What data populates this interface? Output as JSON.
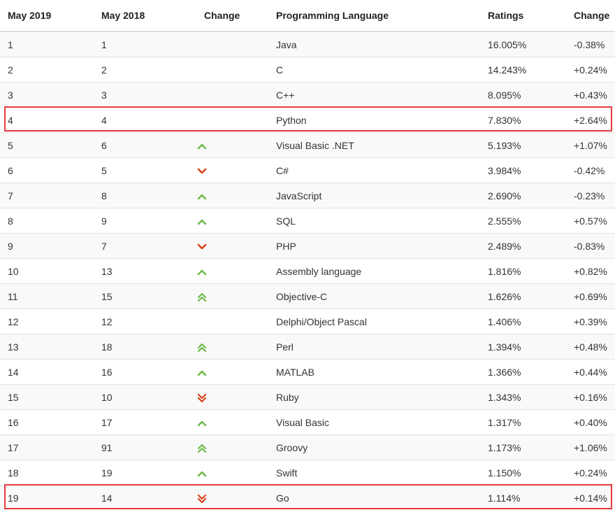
{
  "headers": [
    "May 2019",
    "May 2018",
    "Change",
    "Programming Language",
    "Ratings",
    "Change"
  ],
  "colors": {
    "up": "#6dbb4a",
    "down": "#d9401a",
    "highlight": "#e53a40"
  },
  "rows": [
    {
      "rank2019": "1",
      "rank2018": "1",
      "change_icon": "",
      "language": "Java",
      "rating": "16.005%",
      "delta": "-0.38%"
    },
    {
      "rank2019": "2",
      "rank2018": "2",
      "change_icon": "",
      "language": "C",
      "rating": "14.243%",
      "delta": "+0.24%"
    },
    {
      "rank2019": "3",
      "rank2018": "3",
      "change_icon": "",
      "language": "C++",
      "rating": "8.095%",
      "delta": "+0.43%"
    },
    {
      "rank2019": "4",
      "rank2018": "4",
      "change_icon": "",
      "language": "Python",
      "rating": "7.830%",
      "delta": "+2.64%"
    },
    {
      "rank2019": "5",
      "rank2018": "6",
      "change_icon": "chevron-up-icon",
      "language": "Visual Basic .NET",
      "rating": "5.193%",
      "delta": "+1.07%"
    },
    {
      "rank2019": "6",
      "rank2018": "5",
      "change_icon": "chevron-down-icon",
      "language": "C#",
      "rating": "3.984%",
      "delta": "-0.42%"
    },
    {
      "rank2019": "7",
      "rank2018": "8",
      "change_icon": "chevron-up-icon",
      "language": "JavaScript",
      "rating": "2.690%",
      "delta": "-0.23%"
    },
    {
      "rank2019": "8",
      "rank2018": "9",
      "change_icon": "chevron-up-icon",
      "language": "SQL",
      "rating": "2.555%",
      "delta": "+0.57%"
    },
    {
      "rank2019": "9",
      "rank2018": "7",
      "change_icon": "chevron-down-icon",
      "language": "PHP",
      "rating": "2.489%",
      "delta": "-0.83%"
    },
    {
      "rank2019": "10",
      "rank2018": "13",
      "change_icon": "chevron-up-icon",
      "language": "Assembly language",
      "rating": "1.816%",
      "delta": "+0.82%"
    },
    {
      "rank2019": "11",
      "rank2018": "15",
      "change_icon": "double-chevron-up-icon",
      "language": "Objective-C",
      "rating": "1.626%",
      "delta": "+0.69%"
    },
    {
      "rank2019": "12",
      "rank2018": "12",
      "change_icon": "",
      "language": "Delphi/Object Pascal",
      "rating": "1.406%",
      "delta": "+0.39%"
    },
    {
      "rank2019": "13",
      "rank2018": "18",
      "change_icon": "double-chevron-up-icon",
      "language": "Perl",
      "rating": "1.394%",
      "delta": "+0.48%"
    },
    {
      "rank2019": "14",
      "rank2018": "16",
      "change_icon": "chevron-up-icon",
      "language": "MATLAB",
      "rating": "1.366%",
      "delta": "+0.44%"
    },
    {
      "rank2019": "15",
      "rank2018": "10",
      "change_icon": "double-chevron-down-icon",
      "language": "Ruby",
      "rating": "1.343%",
      "delta": "+0.16%"
    },
    {
      "rank2019": "16",
      "rank2018": "17",
      "change_icon": "chevron-up-icon",
      "language": "Visual Basic",
      "rating": "1.317%",
      "delta": "+0.40%"
    },
    {
      "rank2019": "17",
      "rank2018": "91",
      "change_icon": "double-chevron-up-icon",
      "language": "Groovy",
      "rating": "1.173%",
      "delta": "+1.06%"
    },
    {
      "rank2019": "18",
      "rank2018": "19",
      "change_icon": "chevron-up-icon",
      "language": "Swift",
      "rating": "1.150%",
      "delta": "+0.24%"
    },
    {
      "rank2019": "19",
      "rank2018": "14",
      "change_icon": "double-chevron-down-icon",
      "language": "Go",
      "rating": "1.114%",
      "delta": "+0.14%"
    }
  ],
  "highlighted_rows": [
    "4",
    "19"
  ]
}
